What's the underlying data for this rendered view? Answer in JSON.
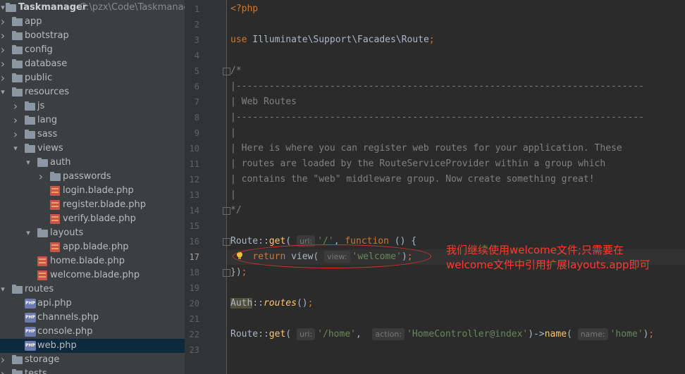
{
  "project": {
    "name": "Taskmanager",
    "path": "C:\\pzx\\Code\\Taskmanage"
  },
  "tree": [
    {
      "label": "app",
      "type": "folder",
      "indent": 0,
      "arrow": "right"
    },
    {
      "label": "bootstrap",
      "type": "folder",
      "indent": 0,
      "arrow": "right"
    },
    {
      "label": "config",
      "type": "folder",
      "indent": 0,
      "arrow": "right"
    },
    {
      "label": "database",
      "type": "folder",
      "indent": 0,
      "arrow": "right"
    },
    {
      "label": "public",
      "type": "folder",
      "indent": 0,
      "arrow": "right"
    },
    {
      "label": "resources",
      "type": "folder",
      "indent": 0,
      "arrow": "down"
    },
    {
      "label": "js",
      "type": "folder",
      "indent": 1,
      "arrow": "right"
    },
    {
      "label": "lang",
      "type": "folder",
      "indent": 1,
      "arrow": "right"
    },
    {
      "label": "sass",
      "type": "folder",
      "indent": 1,
      "arrow": "right"
    },
    {
      "label": "views",
      "type": "folder",
      "indent": 1,
      "arrow": "down"
    },
    {
      "label": "auth",
      "type": "folder",
      "indent": 2,
      "arrow": "down"
    },
    {
      "label": "passwords",
      "type": "folder",
      "indent": 3,
      "arrow": "right"
    },
    {
      "label": "login.blade.php",
      "type": "blade",
      "indent": 3,
      "arrow": ""
    },
    {
      "label": "register.blade.php",
      "type": "blade",
      "indent": 3,
      "arrow": ""
    },
    {
      "label": "verify.blade.php",
      "type": "blade",
      "indent": 3,
      "arrow": ""
    },
    {
      "label": "layouts",
      "type": "folder",
      "indent": 2,
      "arrow": "down"
    },
    {
      "label": "app.blade.php",
      "type": "blade",
      "indent": 3,
      "arrow": ""
    },
    {
      "label": "home.blade.php",
      "type": "blade",
      "indent": 2,
      "arrow": ""
    },
    {
      "label": "welcome.blade.php",
      "type": "blade",
      "indent": 2,
      "arrow": ""
    },
    {
      "label": "routes",
      "type": "folder",
      "indent": 0,
      "arrow": "down"
    },
    {
      "label": "api.php",
      "type": "php",
      "indent": 1,
      "arrow": ""
    },
    {
      "label": "channels.php",
      "type": "php",
      "indent": 1,
      "arrow": ""
    },
    {
      "label": "console.php",
      "type": "php",
      "indent": 1,
      "arrow": ""
    },
    {
      "label": "web.php",
      "type": "php",
      "indent": 1,
      "arrow": "",
      "selected": true
    },
    {
      "label": "storage",
      "type": "folder",
      "indent": 0,
      "arrow": "right"
    },
    {
      "label": "tests",
      "type": "folder",
      "indent": 0,
      "arrow": "right"
    }
  ],
  "editor": {
    "current_line": 17,
    "line_numbers": [
      "1",
      "2",
      "3",
      "4",
      "5",
      "6",
      "7",
      "8",
      "9",
      "10",
      "11",
      "12",
      "13",
      "14",
      "15",
      "16",
      "17",
      "18",
      "19",
      "20",
      "21",
      "22",
      "23"
    ]
  },
  "annotation": {
    "line1": "我们继续使用welcome文件;只需要在",
    "line2": "welcome文件中引用扩展layouts.app即可"
  },
  "colors": {
    "keyword": "#cc7832",
    "string": "#6a8759",
    "comment": "#808080",
    "annotation": "#ff3b2f"
  }
}
